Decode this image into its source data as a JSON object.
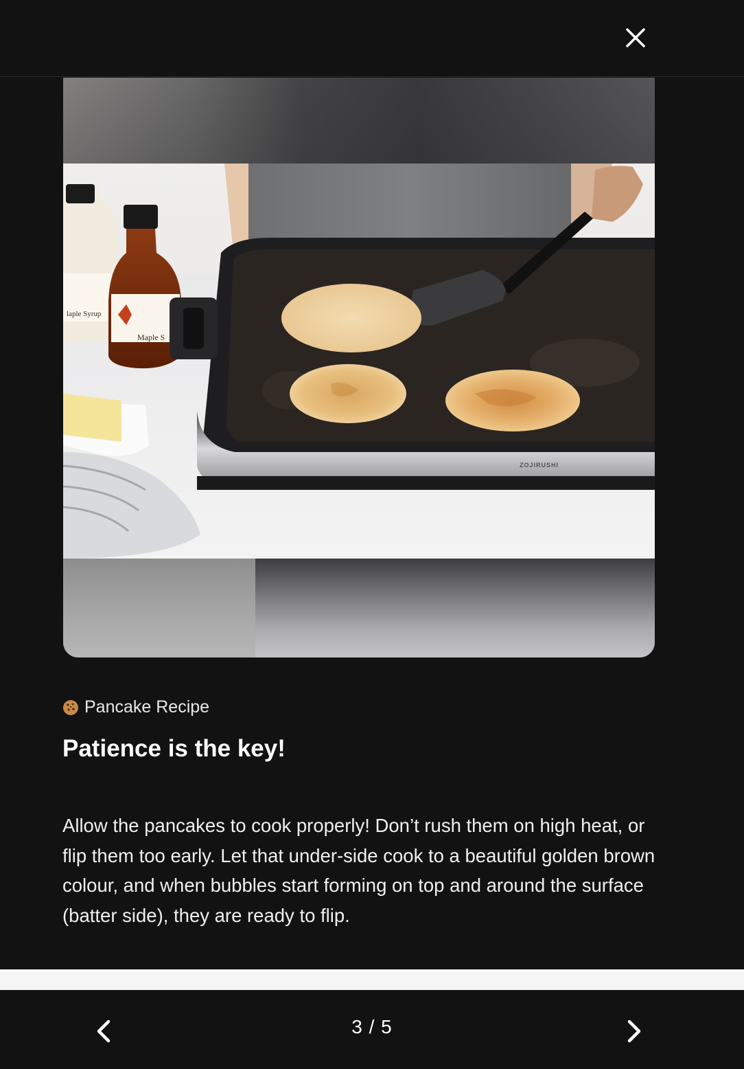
{
  "header": {
    "close_icon": "close-icon"
  },
  "media": {
    "image_alt": "Pancakes cooking on an electric griddle",
    "griddle_brand_mark": "ZOJIRUSHI"
  },
  "content": {
    "category_icon": "cookie-icon",
    "category": "Pancake Recipe",
    "title": "Patience is the key!",
    "body": "Allow the pancakes to cook properly! Don’t rush them on high heat, or flip them too early. Let that under-side cook to a beautiful golden brown colour, and when bubbles start forming on top and around the surface (batter side), they are ready to flip."
  },
  "pager": {
    "counter": "3 / 5",
    "prev_icon": "chevron-left-icon",
    "next_icon": "chevron-right-icon"
  },
  "colors": {
    "background": "#121212",
    "text": "#ffffff",
    "divider": "#f6f6f6"
  }
}
